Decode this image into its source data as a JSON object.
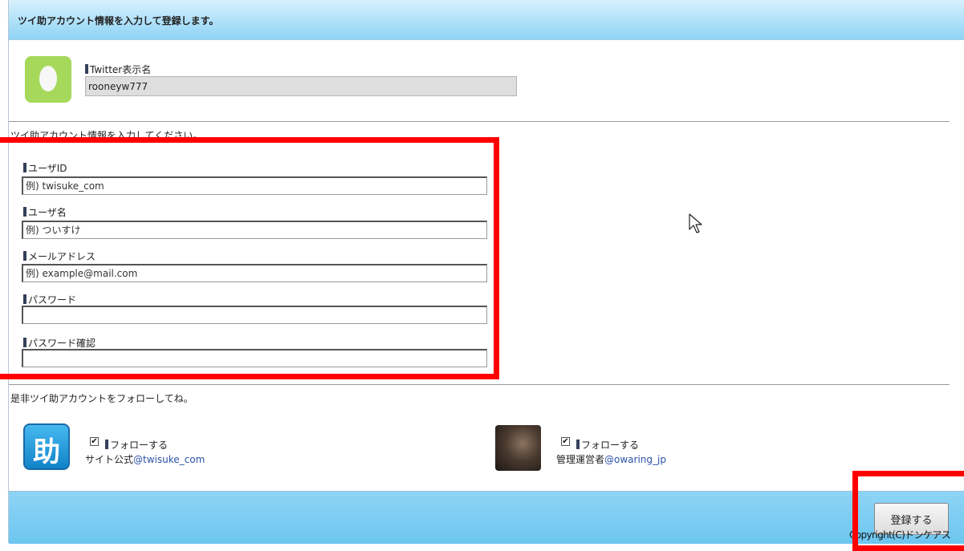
{
  "header": {
    "title": "ツイ助アカウント情報を入力して登録します。"
  },
  "twitter": {
    "label": "Twitter表示名",
    "value": "rooneyw777"
  },
  "form": {
    "instruction": "ツイ助アカウント情報を入力してください。",
    "fields": [
      {
        "label": "ユーザID",
        "placeholder": "例) twisuke_com"
      },
      {
        "label": "ユーザ名",
        "placeholder": "例) ついすけ"
      },
      {
        "label": "メールアドレス",
        "placeholder": "例) example@mail.com"
      },
      {
        "label": "パスワード",
        "placeholder": ""
      },
      {
        "label": "パスワード確認",
        "placeholder": ""
      }
    ]
  },
  "follow": {
    "prompt": "是非ツイ助アカウントをフォローしてね。",
    "accounts": [
      {
        "avatar_text": "助",
        "checked": true,
        "follow_label": "フォローする",
        "desc_prefix": "サイト公式",
        "handle": "@twisuke_com"
      },
      {
        "checked": true,
        "follow_label": "フォローする",
        "desc_prefix": "管理運営者",
        "handle": "@owaring_jp"
      }
    ]
  },
  "footer": {
    "submit_label": "登録する",
    "copyright": "Copyright(C)ドンケアス"
  },
  "colors": {
    "header_gradient": [
      "#d8f0fd",
      "#8ed4f5"
    ],
    "highlight": "#ff0000",
    "link": "#2a52a8"
  }
}
